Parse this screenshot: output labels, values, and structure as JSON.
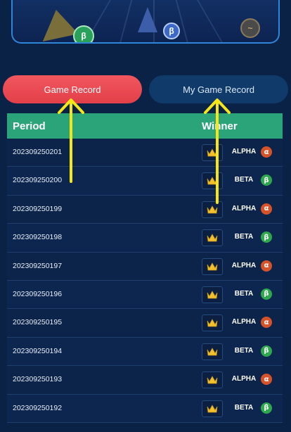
{
  "tabs": {
    "game_record": "Game Record",
    "my_game_record": "My Game Record"
  },
  "table": {
    "headers": {
      "period": "Period",
      "winner": "Winner"
    },
    "rows": [
      {
        "period": "202309250201",
        "winner": "ALPHA",
        "symbol": "α",
        "kind": "alpha"
      },
      {
        "period": "202309250200",
        "winner": "BETA",
        "symbol": "β",
        "kind": "beta"
      },
      {
        "period": "202309250199",
        "winner": "ALPHA",
        "symbol": "α",
        "kind": "alpha"
      },
      {
        "period": "202309250198",
        "winner": "BETA",
        "symbol": "β",
        "kind": "beta"
      },
      {
        "period": "202309250197",
        "winner": "ALPHA",
        "symbol": "α",
        "kind": "alpha"
      },
      {
        "period": "202309250196",
        "winner": "BETA",
        "symbol": "β",
        "kind": "beta"
      },
      {
        "period": "202309250195",
        "winner": "ALPHA",
        "symbol": "α",
        "kind": "alpha"
      },
      {
        "period": "202309250194",
        "winner": "BETA",
        "symbol": "β",
        "kind": "beta"
      },
      {
        "period": "202309250193",
        "winner": "ALPHA",
        "symbol": "α",
        "kind": "alpha"
      },
      {
        "period": "202309250192",
        "winner": "BETA",
        "symbol": "β",
        "kind": "beta"
      }
    ]
  },
  "icons": {
    "crown": "crown-icon",
    "arrow": "yellow-arrow-icon"
  },
  "colors": {
    "background": "#0b2247",
    "active_tab": "#e23f49",
    "inactive_tab": "#0f3a6a",
    "header": "#2aa478",
    "alpha": "#d6532a",
    "beta": "#2ea84c",
    "crown": "#f2c12e",
    "arrow": "#f5e61a"
  }
}
